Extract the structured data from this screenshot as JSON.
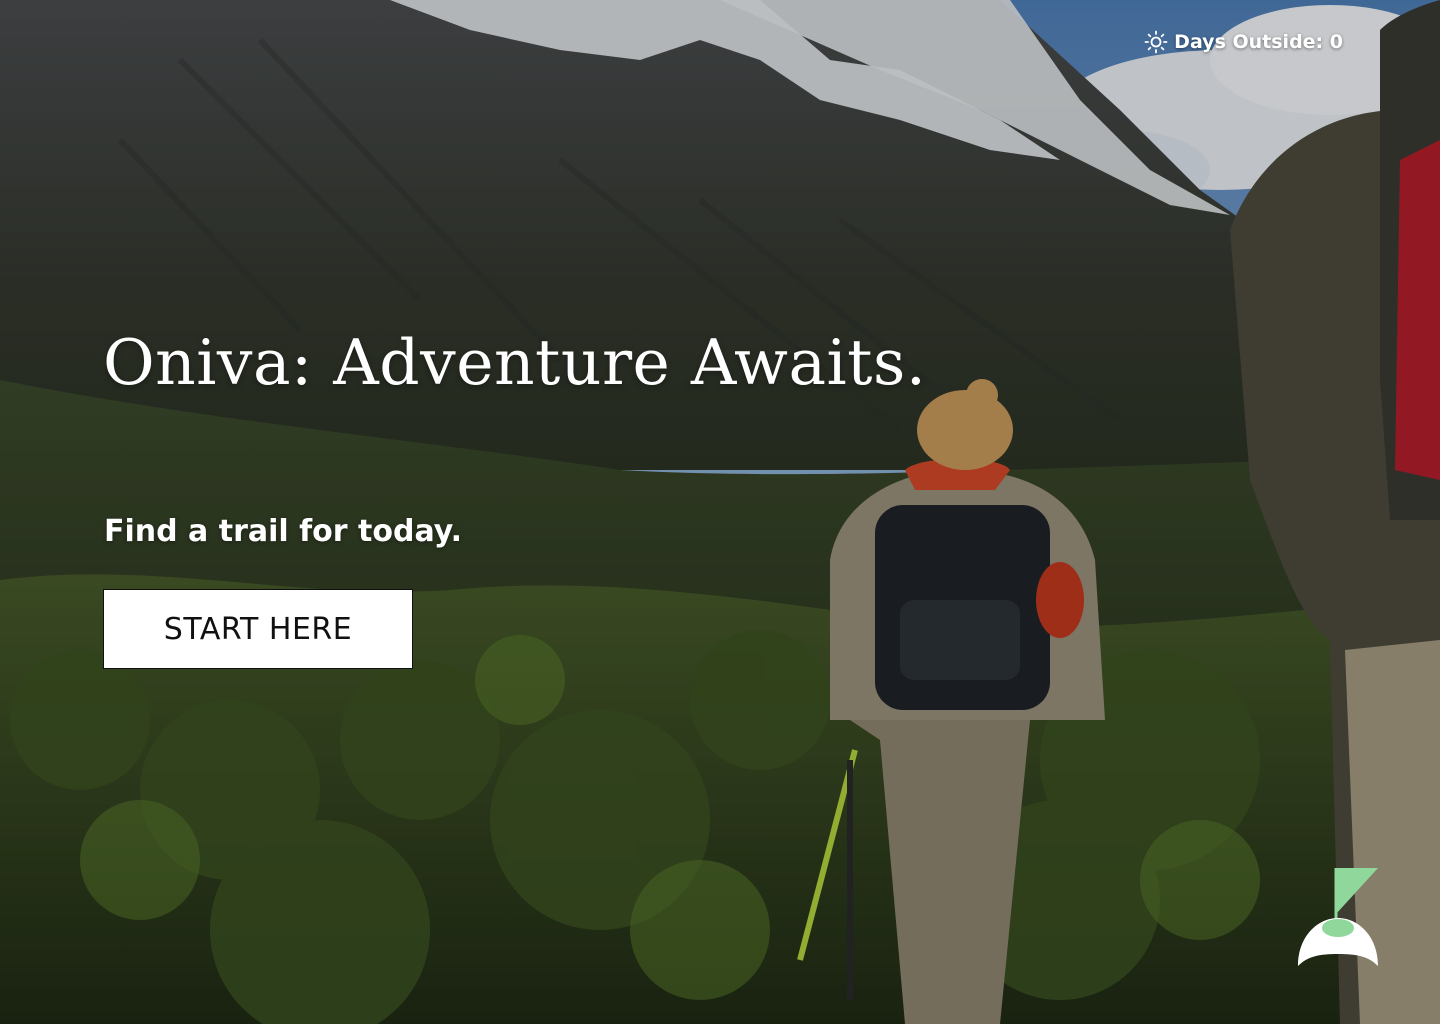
{
  "status": {
    "icon": "sun-icon",
    "days_outside_label": "Days Outside: 0"
  },
  "hero": {
    "image": "mountain-hikers-photo",
    "title": "Oniva: Adventure Awaits.",
    "subtitle": "Find a trail for today.",
    "cta_label": "START HERE"
  },
  "logo": {
    "icon": "flag-on-hill-logo",
    "colors": {
      "flag": "#8fd79a",
      "hill": "#ffffff"
    }
  },
  "colors": {
    "text": "#ffffff",
    "button_bg": "#ffffff",
    "button_text": "#111111"
  }
}
